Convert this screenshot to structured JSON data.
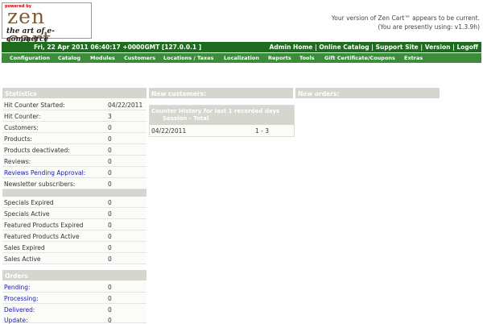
{
  "logo": {
    "powered_by": "powered by",
    "brand": "zen cart",
    "tagline": "the art of e-commerce"
  },
  "version": {
    "line1": "Your version of Zen Cart™ appears to be current.",
    "line2": "(You are presently using: v1.3.9h)"
  },
  "topbar": {
    "datetime": "Fri, 22 Apr 2011 06:40:17 +0000GMT [127.0.0.1 ]",
    "links": [
      "Admin Home",
      "Online Catalog",
      "Support Site",
      "Version",
      "Logoff"
    ],
    "sep": "|"
  },
  "menu": [
    "Configuration",
    "Catalog",
    "Modules",
    "Customers",
    "Locations / Taxes",
    "Localization",
    "Reports",
    "Tools",
    "Gift Certificate/Coupons",
    "Extras"
  ],
  "statistics": {
    "title": "Statistics",
    "rows": [
      {
        "label": "Hit Counter Started:",
        "value": "04/22/2011"
      },
      {
        "label": "Hit Counter:",
        "value": "3"
      },
      {
        "label": "Customers:",
        "value": "0"
      },
      {
        "label": "Products:",
        "value": "0"
      },
      {
        "label": "Products deactivated:",
        "value": "0"
      },
      {
        "label": "Reviews:",
        "value": "0"
      },
      {
        "label": "Reviews Pending Approval:",
        "value": "0"
      },
      {
        "label": "Newsletter subscribers:",
        "value": "0"
      }
    ],
    "rows2": [
      {
        "label": "Specials Expired",
        "value": "0"
      },
      {
        "label": "Specials Active",
        "value": "0"
      },
      {
        "label": "Featured Products Expired",
        "value": "0"
      },
      {
        "label": "Featured Products Active",
        "value": "0"
      },
      {
        "label": "Sales Expired",
        "value": "0"
      },
      {
        "label": "Sales Active",
        "value": "0"
      }
    ]
  },
  "orders": {
    "title": "Orders",
    "rows": [
      {
        "label": "Pending:",
        "value": "0"
      },
      {
        "label": "Processing:",
        "value": "0"
      },
      {
        "label": "Delivered:",
        "value": "0"
      },
      {
        "label": "Update:",
        "value": "0"
      }
    ]
  },
  "new_customers": {
    "title": "New customers:"
  },
  "new_orders": {
    "title": "New orders:"
  },
  "counter": {
    "title": "Counter History for last 1 recorded days",
    "subtitle": "Session - Total",
    "date": "04/22/2011",
    "count": "1 - 3"
  }
}
